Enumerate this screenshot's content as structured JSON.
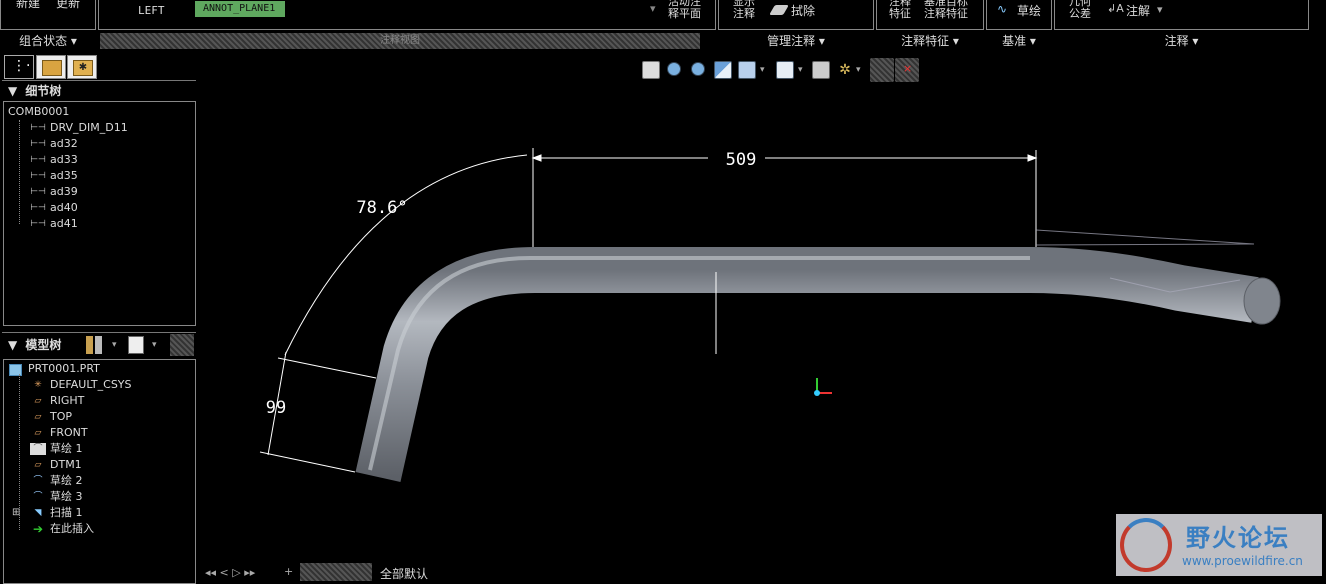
{
  "ribbon": {
    "new_label": "新建",
    "update_label": "更新",
    "view_label": "LEFT",
    "annot_plane": "ANNOT_PLANE1",
    "combo_plane_label": [
      "活动注",
      "释平面"
    ],
    "show_label": [
      "显示",
      "注释"
    ],
    "erase_label": "拭除",
    "annot_feature_label": [
      "注释",
      "特征"
    ],
    "datum_target_label": [
      "基准目标",
      "注释特征"
    ],
    "sketch_label": "草绘",
    "geom_tol_label": [
      "几何",
      "公差"
    ],
    "annotation_label": "注解"
  },
  "groups": {
    "combo_state": "组合状态",
    "hatched_label": "注释视图",
    "manage_annot": "管理注释",
    "annot_feature": "注释特征",
    "datum": "基准",
    "annotation": "注释"
  },
  "detail_tree": {
    "header": "细节树",
    "root": "COMB0001",
    "items": [
      "DRV_DIM_D11",
      "ad32",
      "ad33",
      "ad35",
      "ad39",
      "ad40",
      "ad41"
    ]
  },
  "model_tree": {
    "header": "模型树",
    "items": [
      {
        "label": "PRT0001.PRT",
        "icon": "part-icon"
      },
      {
        "label": "DEFAULT_CSYS",
        "icon": "csys-icon"
      },
      {
        "label": "RIGHT",
        "icon": "datum-plane-icon"
      },
      {
        "label": "TOP",
        "icon": "datum-plane-icon"
      },
      {
        "label": "FRONT",
        "icon": "datum-plane-icon"
      },
      {
        "label": "草绘 1",
        "icon": "sketch-icon"
      },
      {
        "label": "DTM1",
        "icon": "datum-plane-icon"
      },
      {
        "label": "草绘 2",
        "icon": "sketch-arc-icon"
      },
      {
        "label": "草绘 3",
        "icon": "sketch-arc-icon"
      },
      {
        "label": "扫描 1",
        "icon": "sweep-icon"
      },
      {
        "label": "在此插入",
        "icon": "insert-arrow-icon"
      }
    ]
  },
  "dimensions": {
    "length": "509",
    "angle": "78.6°",
    "short_length": "99"
  },
  "status_bar": {
    "filter": "全部默认"
  },
  "watermark": {
    "title": "野火论坛",
    "url": "www.proewildfire.cn"
  },
  "colors": {
    "annot_plane_bg": "#5fa85f",
    "pipe": "#8a8f98",
    "background": "#000000"
  }
}
